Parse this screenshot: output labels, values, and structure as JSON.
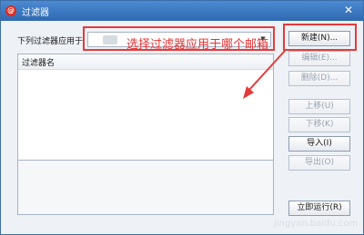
{
  "window": {
    "title": "过滤器",
    "close_glyph": "✕",
    "app_icon": "logo-icon"
  },
  "filter_apply": {
    "label": "下列过滤器应用于:",
    "dropdown_arrow": "▼"
  },
  "filter_list": {
    "column_header": "过滤器名"
  },
  "buttons": {
    "new": "新建(N)...",
    "edit": "编辑(E)...",
    "delete": "删除(D)...",
    "move_up": "上移(U)",
    "move_down": "下移(K)",
    "import": "导入(I)",
    "export": "导出(O)",
    "run_now": "立即运行(R)"
  },
  "annotation": {
    "text": "选择过滤器应用于哪个邮箱",
    "color": "#e53030"
  },
  "watermark": "jingyan.baidu.com",
  "colors": {
    "titlebar": "#3f7cc4",
    "annotation_red": "#e33b3b"
  }
}
